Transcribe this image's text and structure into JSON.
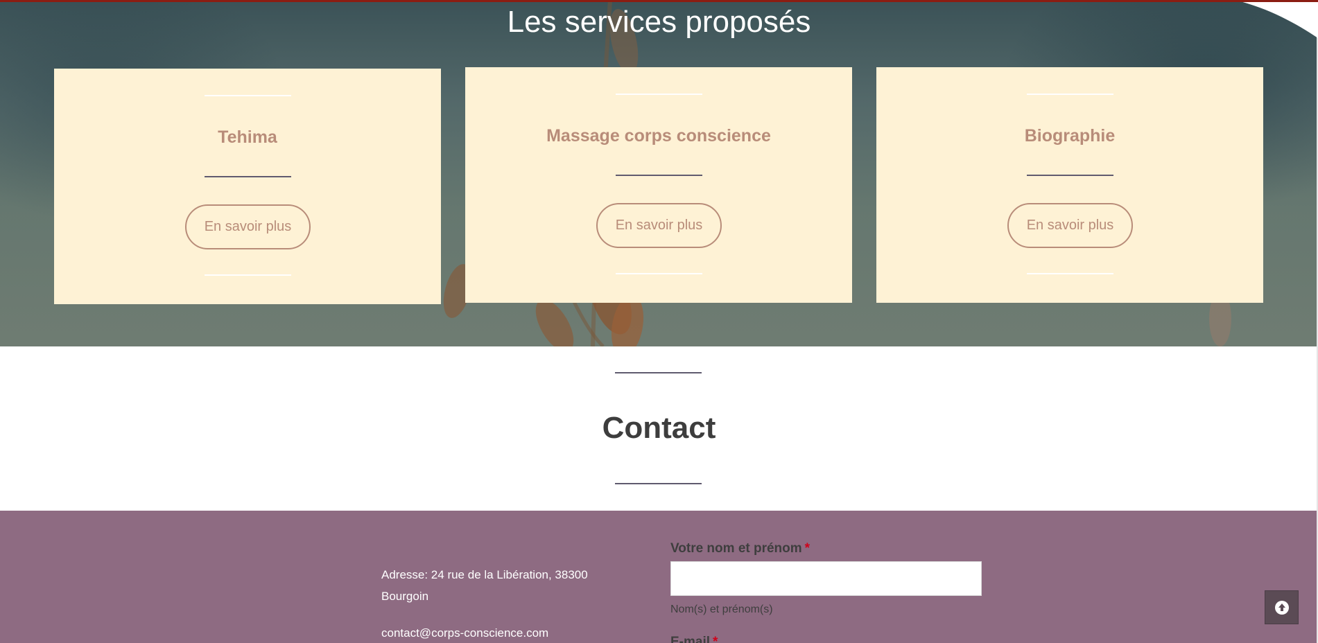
{
  "services": {
    "title": "Les services proposés",
    "cards": [
      {
        "title": "Tehima",
        "button_label": "En savoir plus"
      },
      {
        "title": "Massage corps conscience",
        "button_label": "En savoir plus"
      },
      {
        "title": "Biographie",
        "button_label": "En savoir plus"
      }
    ]
  },
  "contact": {
    "title": "Contact",
    "address": "Adresse: 24 rue de la Libération, 38300 Bourgoin",
    "email": "contact@corps-conscience.com",
    "form": {
      "name_label": "Votre nom et prénom",
      "name_required": "*",
      "name_value": "",
      "name_help": "Nom(s) et prénom(s)",
      "email_label": "E-mail",
      "email_required": "*"
    },
    "scroll_top_icon": "arrow-up-circle-icon"
  },
  "colors": {
    "card_background": "#fef2d5",
    "accent_text": "#b88c79",
    "footer_background": "#8e6b82",
    "top_border": "#8b1d12"
  }
}
